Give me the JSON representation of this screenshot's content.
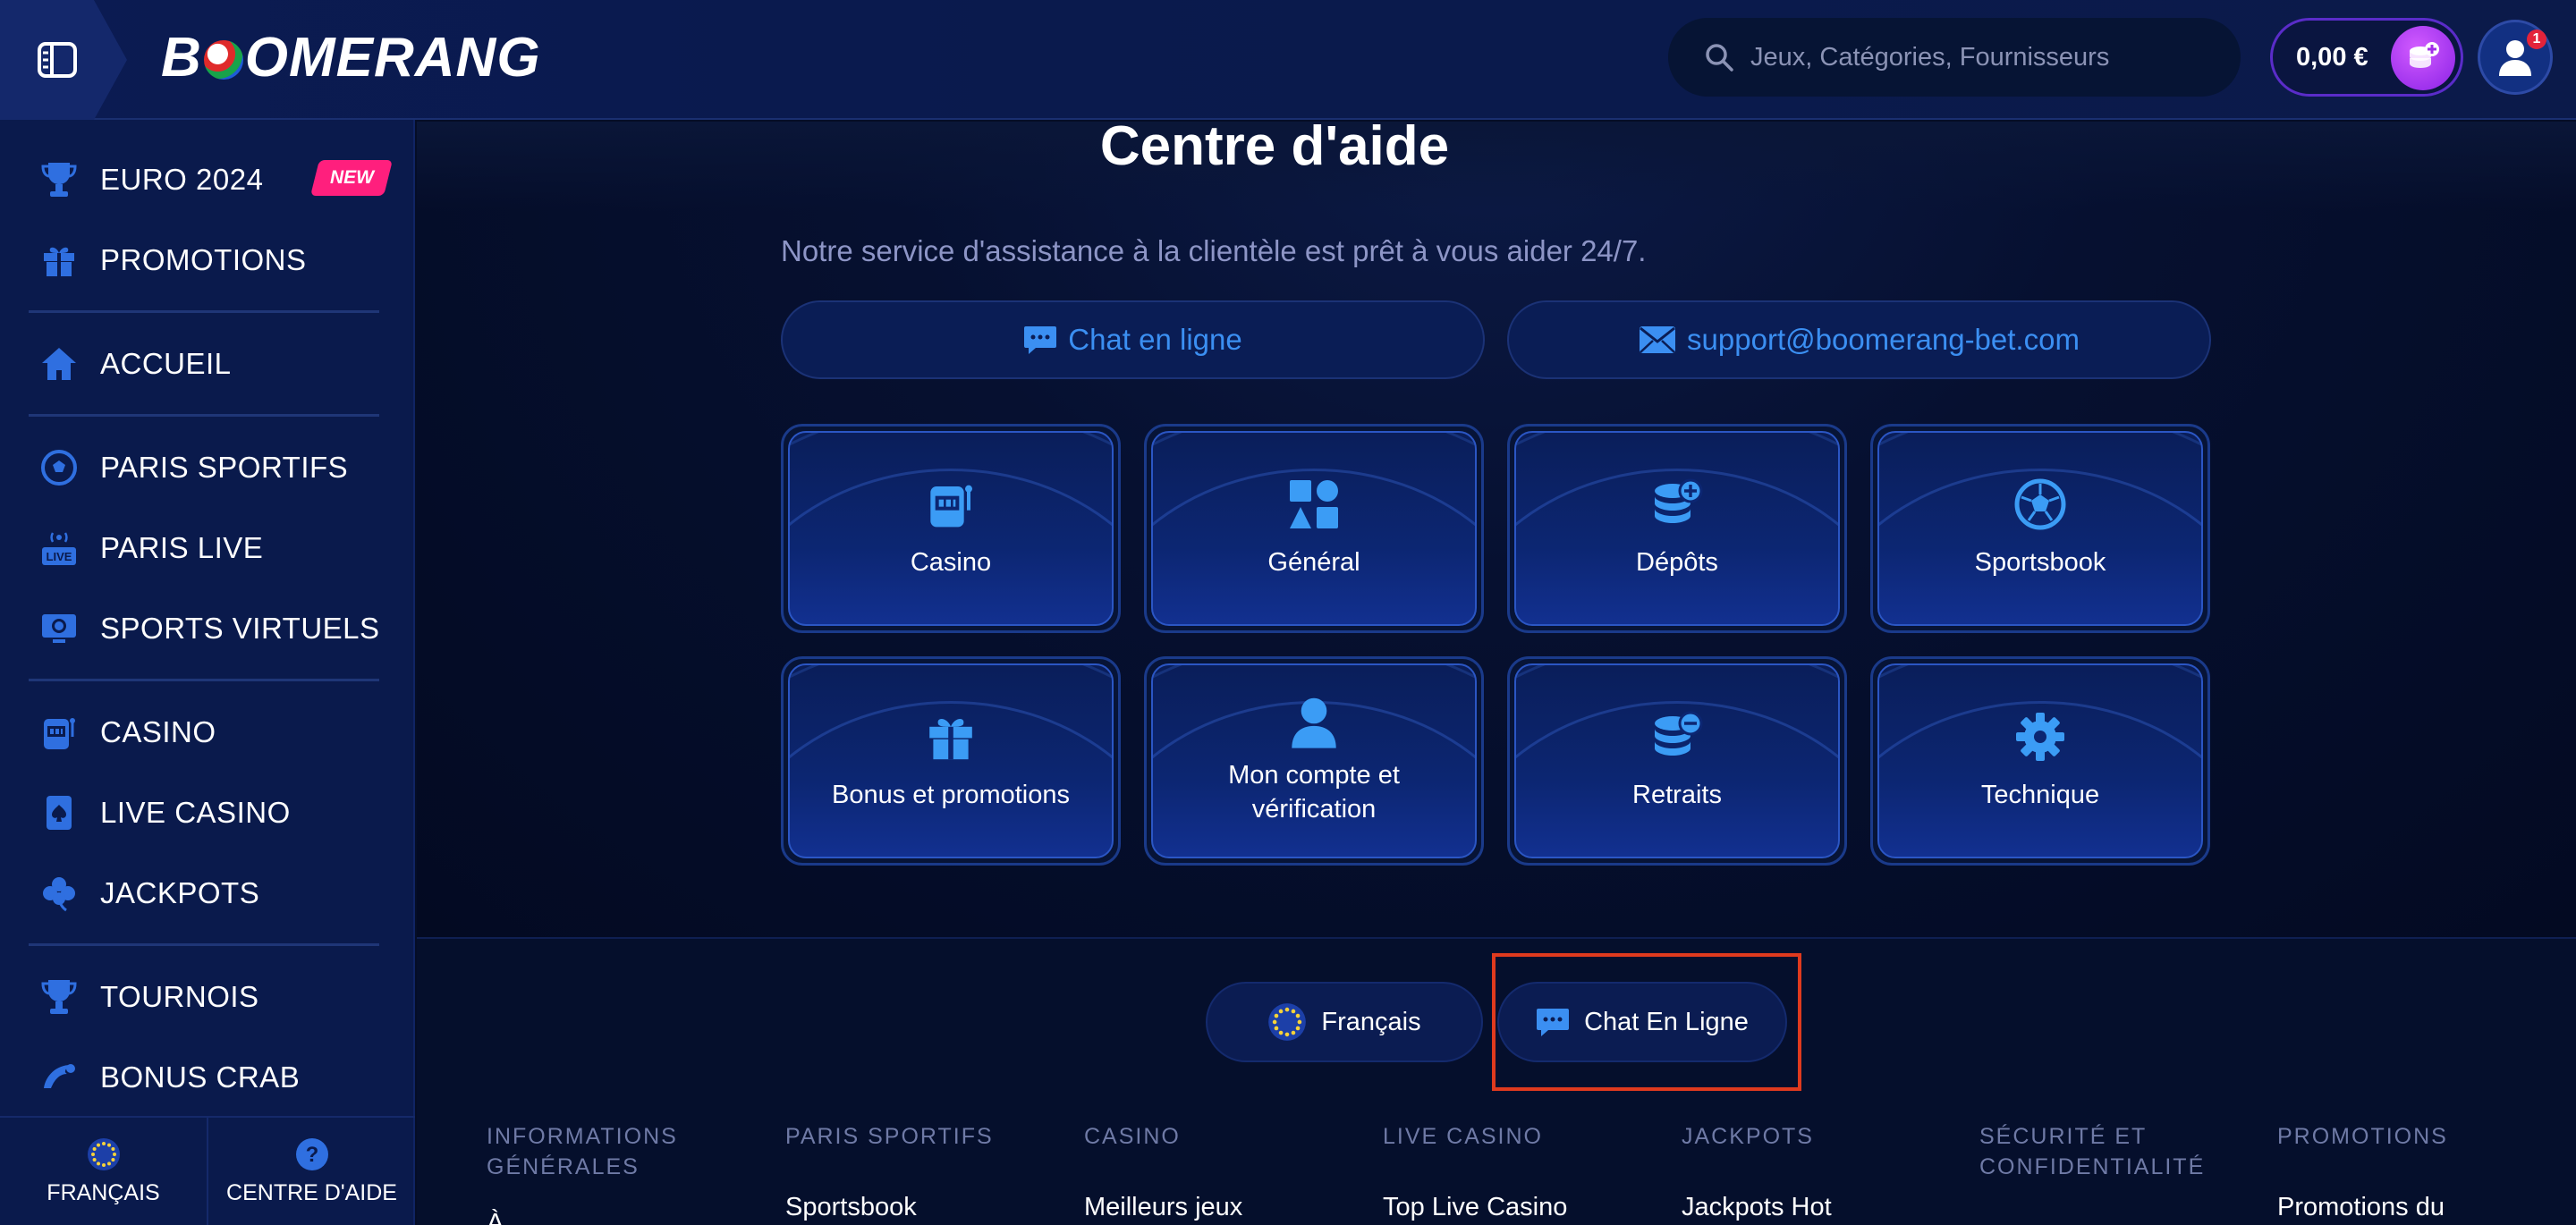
{
  "header": {
    "logo_text_a": "B",
    "logo_text_b": "OMERANG",
    "search_placeholder": "Jeux, Catégories, Fournisseurs",
    "balance": "0,00 €",
    "notification_count": "1"
  },
  "sidebar": {
    "items": [
      {
        "label": "EURO 2024",
        "icon": "trophy-icon"
      },
      {
        "label": "PROMOTIONS",
        "icon": "gift-icon"
      },
      {
        "label": "ACCUEIL",
        "icon": "home-icon"
      },
      {
        "label": "PARIS SPORTIFS",
        "icon": "soccer-ball-icon"
      },
      {
        "label": "PARIS LIVE",
        "icon": "live-icon"
      },
      {
        "label": "SPORTS VIRTUELS",
        "icon": "virtual-sports-icon"
      },
      {
        "label": "CASINO",
        "icon": "slot-machine-icon"
      },
      {
        "label": "LIVE CASINO",
        "icon": "cards-icon"
      },
      {
        "label": "JACKPOTS",
        "icon": "clover-icon"
      },
      {
        "label": "TOURNOIS",
        "icon": "trophy-icon"
      },
      {
        "label": "BONUS CRAB",
        "icon": "crab-icon"
      }
    ],
    "new_badge": "NEW",
    "footer": {
      "language": "FRANÇAIS",
      "help": "CENTRE D'AIDE"
    }
  },
  "main": {
    "title": "Centre d'aide",
    "subtitle": "Notre service d'assistance à la clientèle est prêt à vous aider 24/7.",
    "chat_button": "Chat en ligne",
    "email_button": "support@boomerang-bet.com",
    "categories": [
      {
        "label": "Casino",
        "icon": "slot-machine-icon"
      },
      {
        "label": "Général",
        "icon": "shapes-icon"
      },
      {
        "label": "Dépôts",
        "icon": "coins-plus-icon"
      },
      {
        "label": "Sportsbook",
        "icon": "soccer-ball-icon"
      },
      {
        "label": "Bonus et promotions",
        "icon": "gift-icon"
      },
      {
        "label": "Mon compte et vérification",
        "icon": "user-icon"
      },
      {
        "label": "Retraits",
        "icon": "coins-minus-icon"
      },
      {
        "label": "Technique",
        "icon": "gear-icon"
      }
    ]
  },
  "footer": {
    "language_button": "Français",
    "chat_button": "Chat En Ligne",
    "columns": [
      {
        "heading": "INFORMATIONS GÉNÉRALES",
        "first_link": "À"
      },
      {
        "heading": "PARIS SPORTIFS",
        "first_link": "Sportsbook"
      },
      {
        "heading": "CASINO",
        "first_link": "Meilleurs jeux"
      },
      {
        "heading": "LIVE CASINO",
        "first_link": "Top Live Casino"
      },
      {
        "heading": "JACKPOTS",
        "first_link": "Jackpots Hot"
      },
      {
        "heading": "SÉCURITÉ ET CONFIDENTIALITÉ",
        "first_link": ""
      },
      {
        "heading": "PROMOTIONS",
        "first_link": "Promotions du"
      }
    ]
  },
  "colors": {
    "accent_blue": "#3b8ff2",
    "new_badge": "#ff1f7d",
    "highlight": "#e03a1e",
    "coin_purple": "#b13cf5"
  }
}
